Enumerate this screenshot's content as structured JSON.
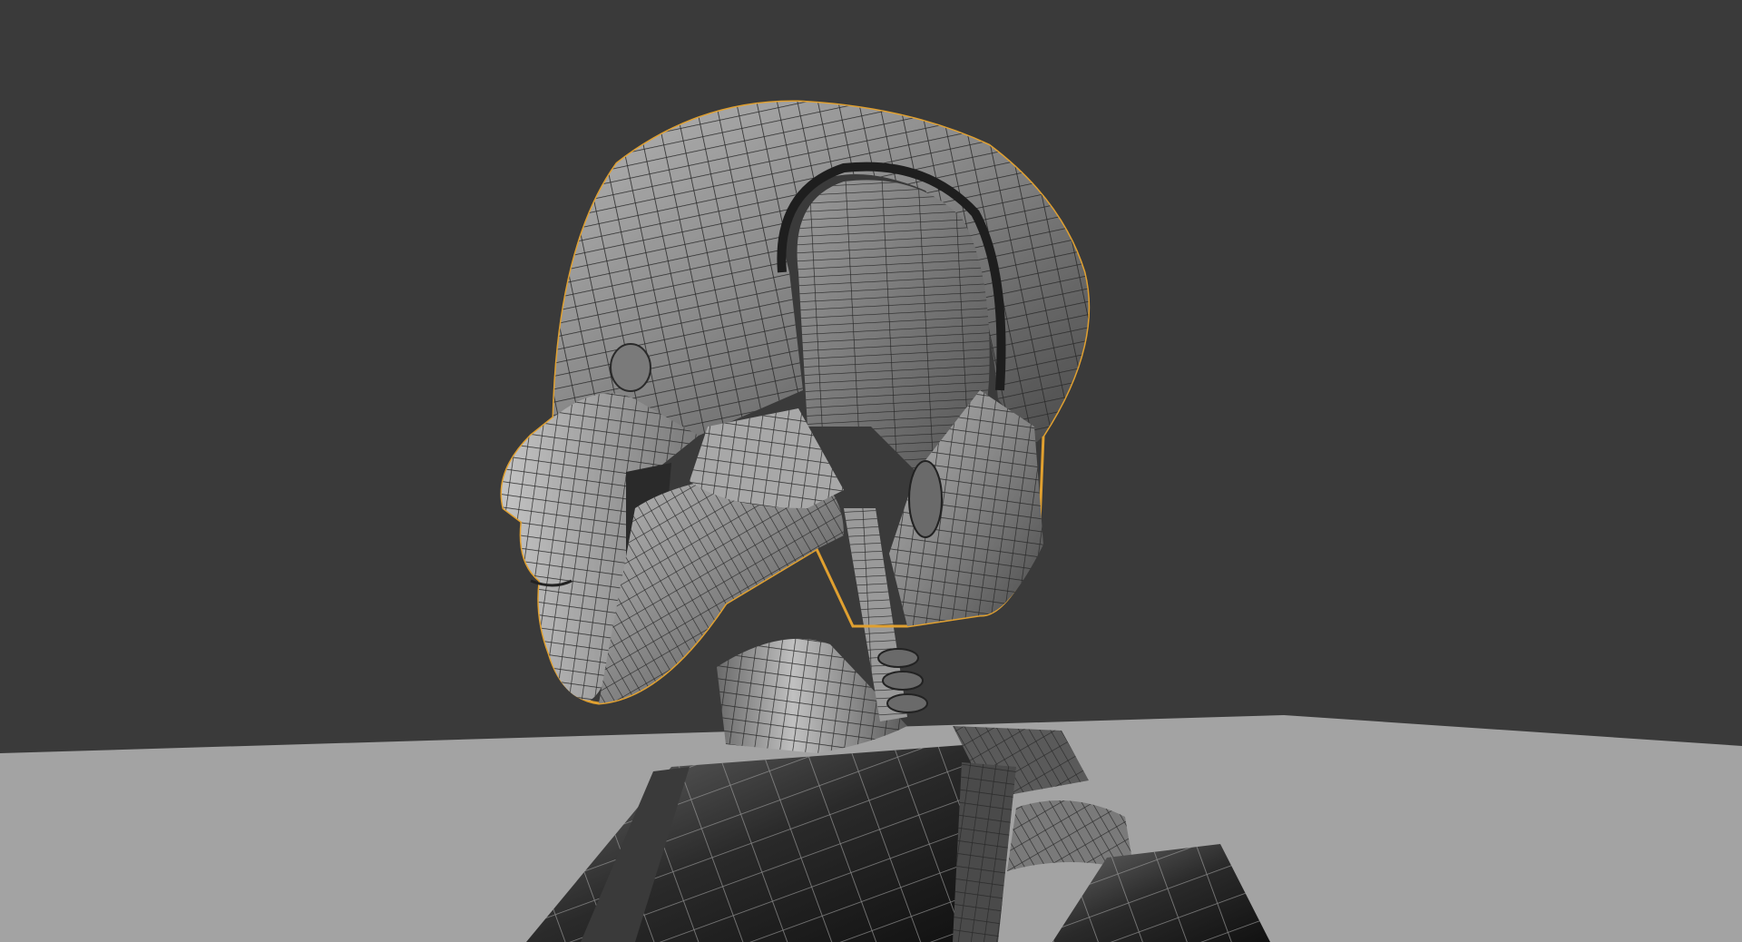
{
  "viewport": {
    "background_color": "#3a3a3a",
    "floor_color": "#a3a3a3",
    "selection_outline_color": "#e0a030",
    "mesh_face_color": "#8a8a8a",
    "mesh_wire_color": "#2a2a2a",
    "shading_mode": "wireframe-overlay",
    "selected_object": "robot-head"
  }
}
